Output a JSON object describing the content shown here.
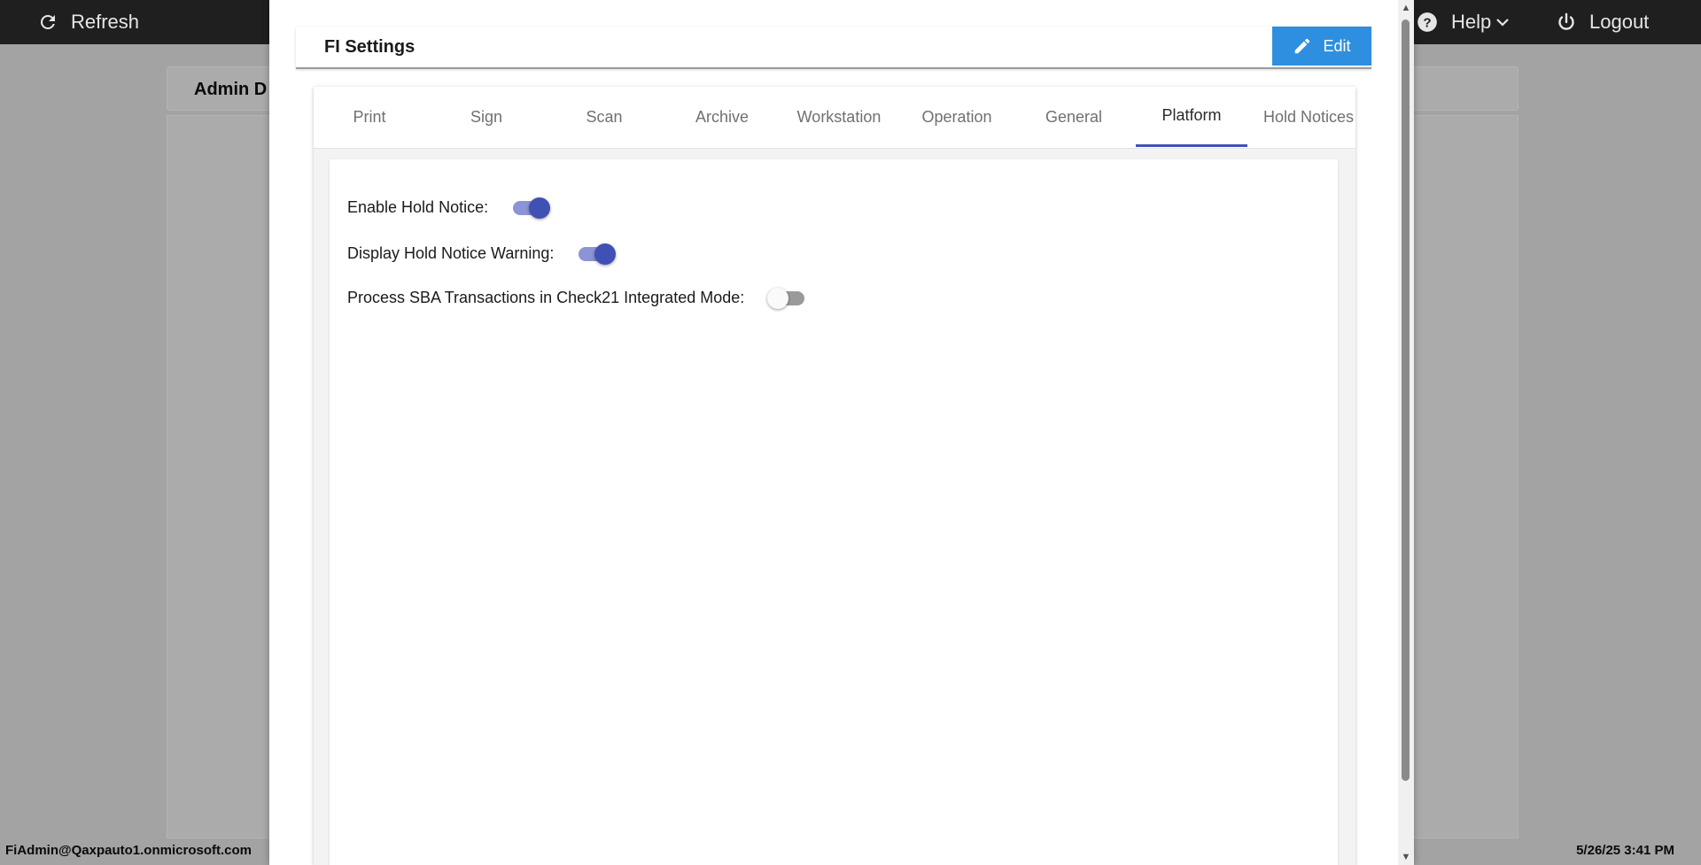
{
  "topbar": {
    "refresh_label": "Refresh",
    "help_label": "Help",
    "logout_label": "Logout"
  },
  "background": {
    "admin_title": "Admin D",
    "footer_user": "FiAdmin@Qaxpauto1.onmicrosoft.com",
    "footer_datetime": "5/26/25 3:41 PM"
  },
  "modal": {
    "title": "FI Settings",
    "edit_label": "Edit",
    "tabs": [
      {
        "label": "Print"
      },
      {
        "label": "Sign"
      },
      {
        "label": "Scan"
      },
      {
        "label": "Archive"
      },
      {
        "label": "Workstation"
      },
      {
        "label": "Operation"
      },
      {
        "label": "General"
      },
      {
        "label": "Platform"
      },
      {
        "label": "Hold Notices"
      }
    ],
    "active_tab": "Platform",
    "settings": [
      {
        "label": "Enable Hold Notice:",
        "enabled": true
      },
      {
        "label": "Display Hold Notice Warning:",
        "enabled": true
      },
      {
        "label": "Process SBA Transactions in Check21 Integrated Mode:",
        "enabled": false
      }
    ]
  },
  "colors": {
    "accent": "#3f51b5",
    "edit_button": "#2e8fe0",
    "topbar": "#1f1f1f"
  },
  "icons": {
    "refresh": "refresh-icon",
    "help": "help-circle-icon",
    "logout": "power-icon",
    "edit": "pencil-icon"
  }
}
